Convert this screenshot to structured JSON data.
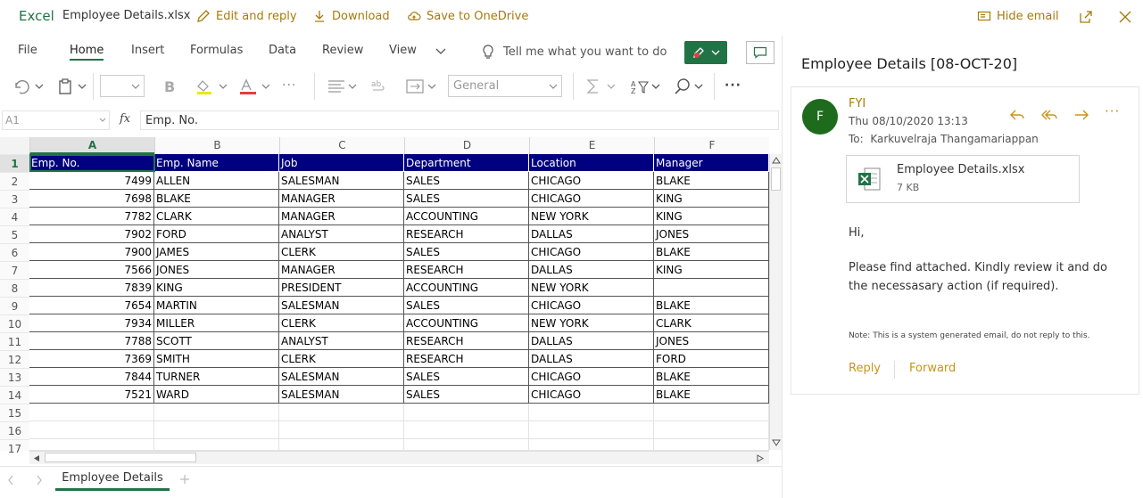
{
  "topbar": {
    "app_name": "Excel",
    "file_name": "Employee Details.xlsx",
    "edit_reply": "Edit and reply",
    "download": "Download",
    "save_onedrive": "Save to OneDrive",
    "hide_email": "Hide email"
  },
  "ribbon": {
    "tabs": [
      "File",
      "Home",
      "Insert",
      "Formulas",
      "Data",
      "Review",
      "View"
    ],
    "tell_me": "Tell me what you want to do",
    "number_format": "General"
  },
  "formula_bar": {
    "cell_ref": "A1",
    "fx": "fx",
    "value": "Emp. No."
  },
  "grid": {
    "columns": [
      "A",
      "B",
      "C",
      "D",
      "E",
      "F"
    ],
    "row_numbers": [
      "1",
      "2",
      "3",
      "4",
      "5",
      "6",
      "7",
      "8",
      "9",
      "10",
      "11",
      "12",
      "13",
      "14",
      "15",
      "16",
      "17"
    ],
    "header": [
      "Emp. No.",
      "Emp. Name",
      "Job",
      "Department",
      "Location",
      "Manager"
    ],
    "rows": [
      [
        "7499",
        "ALLEN",
        "SALESMAN",
        "SALES",
        "CHICAGO",
        "BLAKE"
      ],
      [
        "7698",
        "BLAKE",
        "MANAGER",
        "SALES",
        "CHICAGO",
        "KING"
      ],
      [
        "7782",
        "CLARK",
        "MANAGER",
        "ACCOUNTING",
        "NEW YORK",
        "KING"
      ],
      [
        "7902",
        "FORD",
        "ANALYST",
        "RESEARCH",
        "DALLAS",
        "JONES"
      ],
      [
        "7900",
        "JAMES",
        "CLERK",
        "SALES",
        "CHICAGO",
        "BLAKE"
      ],
      [
        "7566",
        "JONES",
        "MANAGER",
        "RESEARCH",
        "DALLAS",
        "KING"
      ],
      [
        "7839",
        "KING",
        "PRESIDENT",
        "ACCOUNTING",
        "NEW YORK",
        ""
      ],
      [
        "7654",
        "MARTIN",
        "SALESMAN",
        "SALES",
        "CHICAGO",
        "BLAKE"
      ],
      [
        "7934",
        "MILLER",
        "CLERK",
        "ACCOUNTING",
        "NEW YORK",
        "CLARK"
      ],
      [
        "7788",
        "SCOTT",
        "ANALYST",
        "RESEARCH",
        "DALLAS",
        "JONES"
      ],
      [
        "7369",
        "SMITH",
        "CLERK",
        "RESEARCH",
        "DALLAS",
        "FORD"
      ],
      [
        "7844",
        "TURNER",
        "SALESMAN",
        "SALES",
        "CHICAGO",
        "BLAKE"
      ],
      [
        "7521",
        "WARD",
        "SALESMAN",
        "SALES",
        "CHICAGO",
        "BLAKE"
      ]
    ]
  },
  "sheet_tabs": {
    "active": "Employee Details"
  },
  "mail": {
    "title": "Employee Details [08-OCT-20]",
    "avatar_letter": "F",
    "sender": "FYI",
    "date": "Thu 08/10/2020 13:13",
    "to_label": "To:",
    "to": "Karkuvelraja Thangamariappan",
    "attachment_name": "Employee Details.xlsx",
    "attachment_size": "7 KB",
    "greeting": "Hi,",
    "body": "Please find attached. Kindly review it and do the necessasary action (if required).",
    "note": "Note: This is a system generated email, do not reply to this.",
    "reply": "Reply",
    "forward": "Forward"
  },
  "colors": {
    "excel_green": "#217346",
    "header_fill": "#000080",
    "accent": "#a77a0c",
    "avatar": "#1e6b1e"
  }
}
